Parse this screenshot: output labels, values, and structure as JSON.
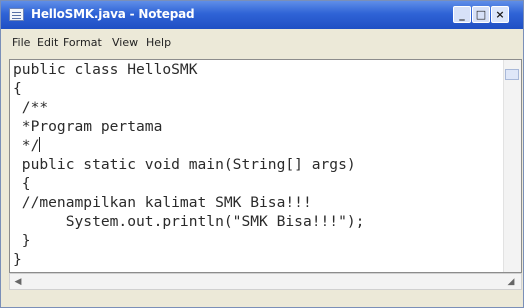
{
  "window": {
    "title": "HelloSMK.java - Notepad",
    "icon": "notepad-icon",
    "controls": {
      "minimize": "_",
      "maximize": "□",
      "close": "×"
    }
  },
  "menubar": {
    "items": [
      "File",
      "Edit",
      "Format",
      "View",
      "Help"
    ]
  },
  "editor": {
    "lines": [
      "public class HelloSMK",
      "{",
      " /**",
      " *Program pertama",
      " */",
      " public static void main(String[] args)",
      " {",
      " //menampilkan kalimat SMK Bisa!!!",
      "      System.out.println(\"SMK Bisa!!!\");",
      " }",
      "}"
    ]
  },
  "colors": {
    "titlebar": "#2f63d6",
    "editor_background": "#ffffff",
    "text": "#2b2b2b"
  }
}
